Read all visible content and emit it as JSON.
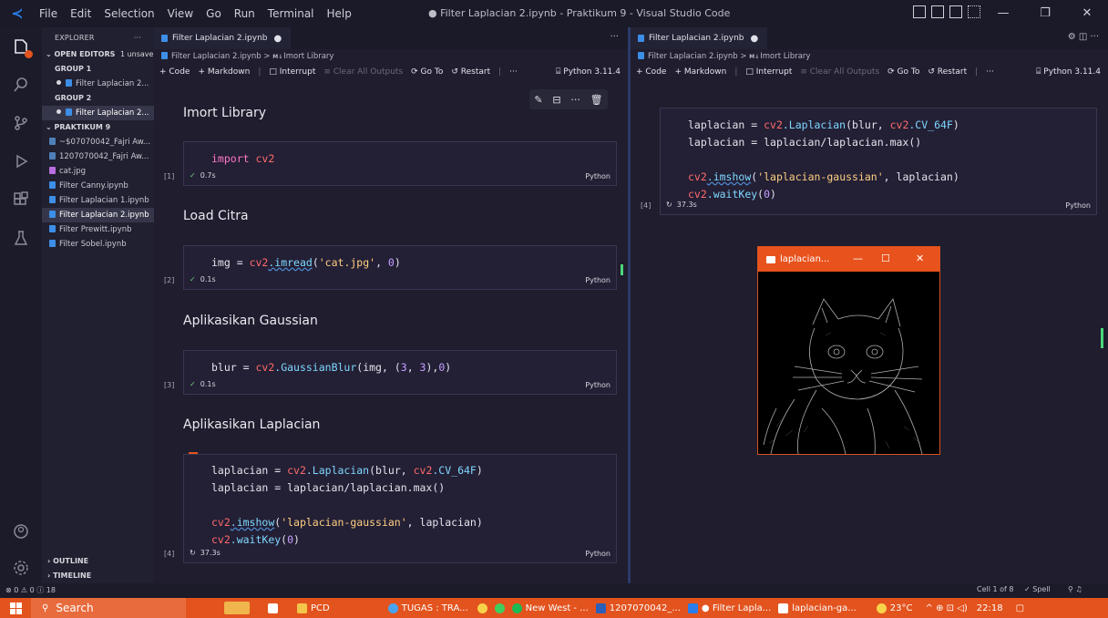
{
  "titlebar": {
    "menu": [
      "File",
      "Edit",
      "Selection",
      "View",
      "Go",
      "Run",
      "Terminal",
      "Help"
    ],
    "title": "● Filter Laplacian 2.ipynb - Praktikum 9 - Visual Studio Code",
    "window_buttons": [
      "—",
      "❐",
      "✕"
    ]
  },
  "sidebar": {
    "explorer_label": "EXPLORER",
    "more": "···",
    "open_editors": "OPEN EDITORS",
    "unsaved": "1 unsaved",
    "group1": "GROUP 1",
    "group1_file": "Filter Laplacian 2...",
    "group2": "GROUP 2",
    "group2_file": "Filter Laplacian 2...",
    "folder": "PRAKTIKUM 9",
    "files": [
      {
        "name": "~$07070042_Fajri Aw...",
        "kind": "doc"
      },
      {
        "name": "1207070042_Fajri Aw...",
        "kind": "doc"
      },
      {
        "name": "cat.jpg",
        "kind": "img"
      },
      {
        "name": "Filter Canny.ipynb",
        "kind": "nb"
      },
      {
        "name": "Filter Laplacian 1.ipynb",
        "kind": "nb"
      },
      {
        "name": "Filter Laplacian 2.ipynb",
        "kind": "nb"
      },
      {
        "name": "Filter Prewitt.ipynb",
        "kind": "nb"
      },
      {
        "name": "Filter Sobel.ipynb",
        "kind": "nb"
      }
    ],
    "outline": "OUTLINE",
    "timeline": "TIMELINE"
  },
  "editor1": {
    "tab": "Filter Laplacian 2.ipynb",
    "tab_dot": "●",
    "tab_more": "···",
    "crumb_file": "Filter Laplacian 2.ipynb",
    "crumb_sep": ">",
    "crumb_md": "M↓",
    "crumb_section": "Imort Library",
    "toolbar": {
      "code": "+ Code",
      "markdown": "+ Markdown",
      "interrupt": "□ Interrupt",
      "clear": "≡ Clear All Outputs",
      "goto": "⟳ Go To",
      "restart": "↺ Restart",
      "more": "···",
      "kernel": "⌸ Python 3.11.4"
    },
    "headings": [
      "Imort Library",
      "Load Citra",
      "Aplikasikan Gaussian",
      "Aplikasikan Laplacian"
    ],
    "cells": [
      {
        "count": "[1]",
        "status": "✓",
        "time": "0.7s",
        "lang": "Python"
      },
      {
        "count": "[2]",
        "status": "✓",
        "time": "0.1s",
        "lang": "Python"
      },
      {
        "count": "[3]",
        "status": "✓",
        "time": "0.1s",
        "lang": "Python"
      },
      {
        "count": "[4]",
        "status": "↻",
        "time": "37.3s",
        "lang": "Python"
      }
    ],
    "code": {
      "c1_kw": "import",
      "c1_mod": "cv2",
      "c2_var": "img",
      "c2_eq": " = ",
      "c2_mod": "cv2",
      "c2_fn": ".imread",
      "c2_args1": "(",
      "c2_str": "'cat.jpg'",
      "c2_args2": ", ",
      "c2_num": "0",
      "c2_args3": ")",
      "c3_var": "blur",
      "c3_eq": " = ",
      "c3_mod": "cv2",
      "c3_fn": ".GaussianBlur",
      "c3_args1": "(img, (",
      "c3_n1": "3",
      "c3_c1": ", ",
      "c3_n2": "3",
      "c3_c2": "),",
      "c3_n3": "0",
      "c3_c3": ")"
    }
  },
  "laplacian_code": {
    "l1_var": "laplacian",
    "l1_eq": " = ",
    "l1_mod": "cv2",
    "l1_fn": ".Laplacian",
    "l1_args1": "(blur, ",
    "l1_mod2": "cv2",
    "l1_const": ".CV_64F",
    "l1_args2": ")",
    "l2_var": "laplacian",
    "l2_eq": " = ",
    "l2_rest": "laplacian/laplacian.max()",
    "l3_mod": "cv2",
    "l3_fn": ".imshow",
    "l3_args1": "(",
    "l3_str": "'laplacian-gaussian'",
    "l3_args2": ", laplacian)",
    "l4_mod": "cv2",
    "l4_fn": ".waitKey",
    "l4_args1": "(",
    "l4_num": "0",
    "l4_args2": ")"
  },
  "editor2": {
    "tab": "Filter Laplacian 2.ipynb",
    "tab_dot": "●",
    "tab_actions": "⚙ ◫ ···",
    "crumb_file": "Filter Laplacian 2.ipynb",
    "crumb_sep": ">",
    "crumb_md": "M↓",
    "crumb_section": "Imort Library",
    "cell": {
      "count": "[4]",
      "status": "↻",
      "time": "37.3s",
      "lang": "Python"
    }
  },
  "cvwindow": {
    "title": "laplacian...",
    "min": "—",
    "max": "☐",
    "close": "✕"
  },
  "statusbar": {
    "left": "⊗ 0 ⚠ 0 ⓘ 18",
    "cell": "Cell 1 of 8",
    "spell": "✓ Spell",
    "right_icons": "⚲ ♫"
  },
  "taskbar": {
    "search": "Search",
    "pcd": "PCD",
    "tugas": "TUGAS : TRA...",
    "newwest": "New West - ...",
    "word": "1207070042_...",
    "vscode": "● Filter Lapla...",
    "cvapp": "laplacian-ga...",
    "weather": "23°C",
    "tray": "^ ⊕ ⊡ ◁)",
    "time": "22:18"
  },
  "colors": {
    "accent": "#e3531e",
    "editor_bg": "#1f1d2e",
    "keyword": "#ff79c6",
    "string": "#ffd080"
  }
}
